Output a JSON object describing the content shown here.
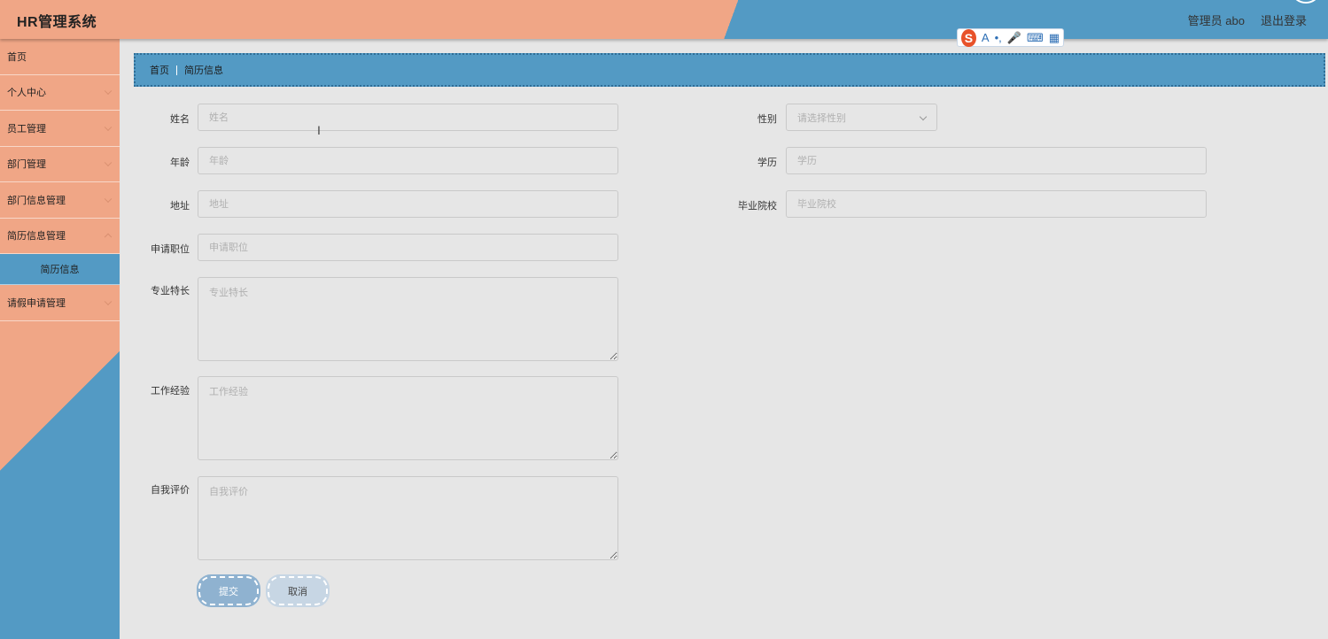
{
  "header": {
    "title": "HR管理系统",
    "user_label": "管理员 abo",
    "logout_label": "退出登录"
  },
  "ime": {
    "logo": "S",
    "items": [
      "A",
      "•,",
      "🎤",
      "⌨",
      "▦"
    ]
  },
  "sidebar": {
    "items": [
      {
        "label": "首页"
      },
      {
        "label": "个人中心"
      },
      {
        "label": "员工管理"
      },
      {
        "label": "部门管理"
      },
      {
        "label": "部门信息管理"
      },
      {
        "label": "简历信息管理"
      },
      {
        "label": "请假申请管理"
      }
    ],
    "sub_active": "简历信息"
  },
  "breadcrumb": {
    "home": "首页",
    "current": "简历信息"
  },
  "form": {
    "name": {
      "label": "姓名",
      "placeholder": "姓名",
      "value": ""
    },
    "gender": {
      "label": "性别",
      "placeholder": "请选择性别"
    },
    "age": {
      "label": "年龄",
      "placeholder": "年龄",
      "value": ""
    },
    "education": {
      "label": "学历",
      "placeholder": "学历",
      "value": ""
    },
    "address": {
      "label": "地址",
      "placeholder": "地址",
      "value": ""
    },
    "school": {
      "label": "毕业院校",
      "placeholder": "毕业院校",
      "value": ""
    },
    "position": {
      "label": "申请职位",
      "placeholder": "申请职位",
      "value": ""
    },
    "skills": {
      "label": "专业特长",
      "placeholder": "专业特长"
    },
    "experience": {
      "label": "工作经验",
      "placeholder": "工作经验"
    },
    "self_eval": {
      "label": "自我评价",
      "placeholder": "自我评价"
    },
    "submit_label": "提交",
    "cancel_label": "取消"
  },
  "colors": {
    "accent_salmon": "#f0a686",
    "accent_blue": "#539ac4",
    "background": "#e6e6e6"
  }
}
